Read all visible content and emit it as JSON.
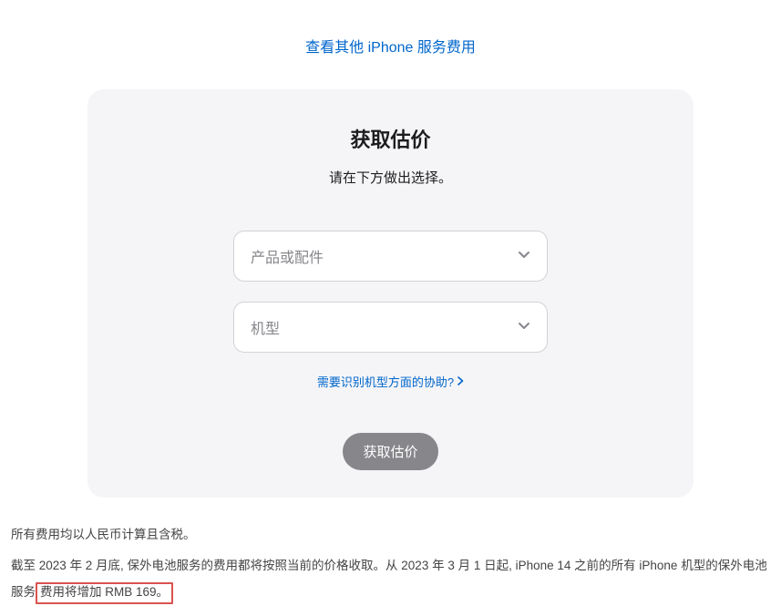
{
  "top_link": {
    "label": "查看其他 iPhone 服务费用"
  },
  "card": {
    "title": "获取估价",
    "subtitle": "请在下方做出选择。",
    "select_product_placeholder": "产品或配件",
    "select_model_placeholder": "机型",
    "help_link_label": "需要识别机型方面的协助?",
    "submit_label": "获取估价"
  },
  "footer": {
    "line1": "所有费用均以人民币计算且含税。",
    "line2_part1": "截至 2023 年 2 月底, 保外电池服务的费用都将按照当前的价格收取。从 2023 年 3 月 1 日起, iPhone 14 之前的所有 iPhone 机型的保外电池服务",
    "line2_highlighted": "费用将增加 RMB 169。"
  }
}
